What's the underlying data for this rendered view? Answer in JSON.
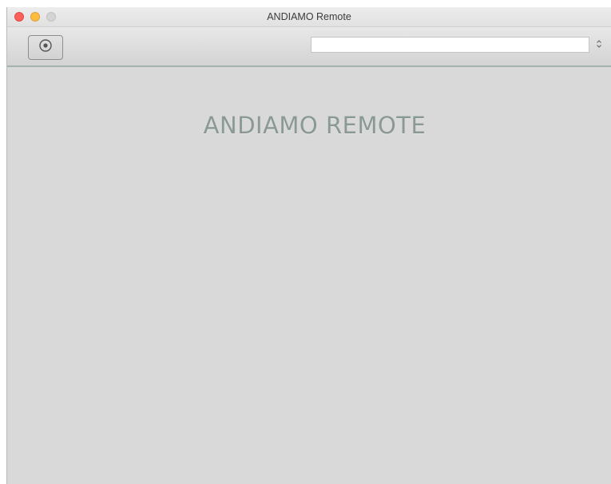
{
  "window": {
    "title": "ANDIAMO Remote"
  },
  "toolbar": {
    "record_button_icon": "target-icon",
    "server_select": {
      "value": "",
      "stepper_icon": "up-down-chevron-icon"
    }
  },
  "main": {
    "heading": "ANDIAMO REMOTE"
  }
}
